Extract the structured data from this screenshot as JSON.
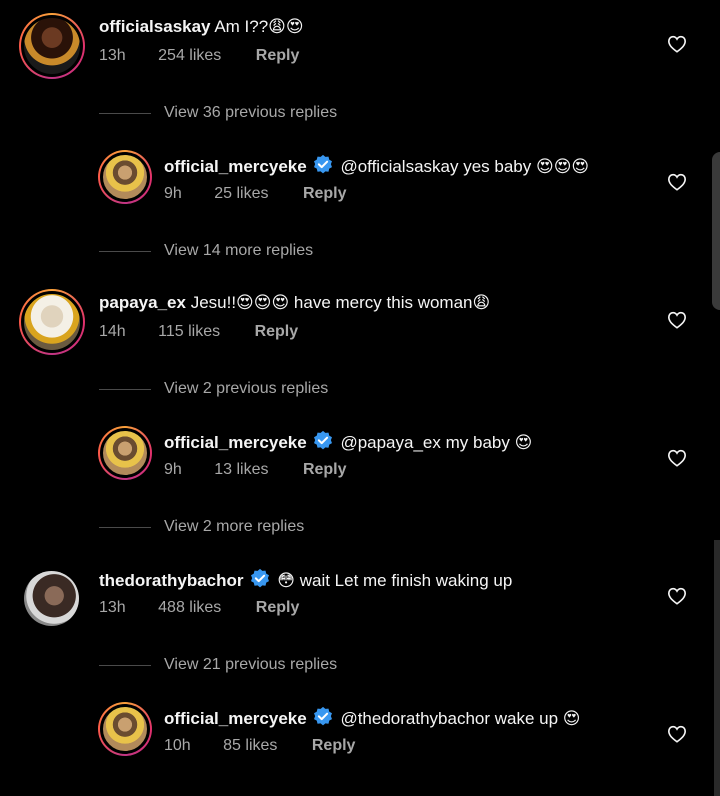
{
  "colors": {
    "background": "#000000",
    "text": "#f5f5f5",
    "secondary": "#a8a8a8",
    "verified": "#3897f0"
  },
  "comments": [
    {
      "username": "officialsaskay",
      "verified": false,
      "text": "Am I??",
      "emoji": "😩😍",
      "time": "13h",
      "likes": "254 likes",
      "reply": "Reply"
    },
    {
      "username": "official_mercyeke",
      "verified": true,
      "text": "@officialsaskay yes baby",
      "emoji": "😍😍😍",
      "time": "9h",
      "likes": "25 likes",
      "reply": "Reply"
    },
    {
      "username": "papaya_ex",
      "verified": false,
      "text": "Jesu!!😍😍😍 have mercy this woman",
      "emoji": "😩",
      "time": "14h",
      "likes": "115 likes",
      "reply": "Reply"
    },
    {
      "username": "official_mercyeke",
      "verified": true,
      "text": "@papaya_ex my baby",
      "emoji": "😍",
      "time": "9h",
      "likes": "13 likes",
      "reply": "Reply"
    },
    {
      "username": "thedorathybachor",
      "verified": true,
      "text": "😳 wait Let me finish waking up",
      "emoji": "",
      "time": "13h",
      "likes": "488 likes",
      "reply": "Reply"
    },
    {
      "username": "official_mercyeke",
      "verified": true,
      "text": "@thedorathybachor wake up",
      "emoji": "😍",
      "time": "10h",
      "likes": "85 likes",
      "reply": "Reply"
    }
  ],
  "view_replies": [
    "View 36 previous replies",
    "View 14 more replies",
    "View 2 previous replies",
    "View 2 more replies",
    "View 21 previous replies"
  ]
}
